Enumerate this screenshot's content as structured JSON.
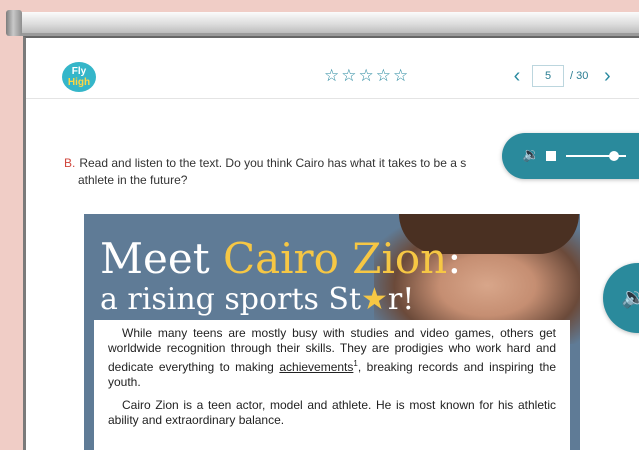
{
  "app": {
    "logo_lines": [
      "Fly",
      "High"
    ]
  },
  "rating": {
    "stars": 5,
    "filled": 0,
    "glyph": "☆"
  },
  "pager": {
    "prev": "‹",
    "next": "›",
    "current": "5",
    "total": "/ 30"
  },
  "instruction": {
    "letter": "B.",
    "text": "Read and listen to the text. Do you think Cairo has what it takes to be a s",
    "text_cont": "athlete in the future?"
  },
  "audio": {
    "speaker_icon": "🔉",
    "progress": 0.8
  },
  "article": {
    "title_part1": "Meet ",
    "title_part2": "Cairo Zion",
    "title_part3": ":",
    "subtitle_a": "a rising sports St",
    "subtitle_star": "★",
    "subtitle_b": "r!",
    "para1_a": "While many teens are mostly busy with studies and video games, others get worldwide recognition through their skills. They are prodigies who work hard and dedicate everything to making ",
    "para1_link": "achievements",
    "para1_sup": "1",
    "para1_b": ", breaking records and inspiring the youth.",
    "para2": "Cairo Zion is a teen actor, model and athlete. He is most known for his athletic ability and extraordinary balance."
  },
  "colors": {
    "accent": "#2a8a9c",
    "letter": "#d0463c",
    "gold": "#f6c744",
    "panel": "#5f7b96"
  }
}
